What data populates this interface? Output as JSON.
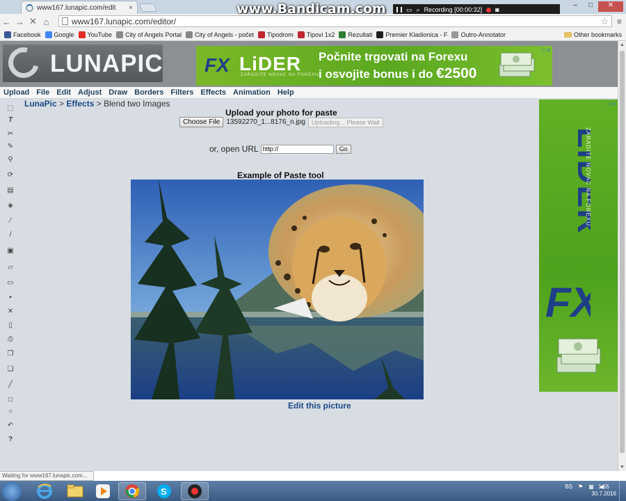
{
  "watermark": "www.Bandicam.com",
  "recorder": {
    "status": "Recording [00:00:32]"
  },
  "browser": {
    "tab_title": "www167.lunapic.com/edit",
    "tab_close": "×",
    "url": "www167.lunapic.com/editor/",
    "bookmarks": [
      {
        "label": "Facebook",
        "color": "#3b5998"
      },
      {
        "label": "Google",
        "color": "#4285f4"
      },
      {
        "label": "YouTube",
        "color": "#e52d27"
      },
      {
        "label": "City of Angels Portal",
        "color": "#888888"
      },
      {
        "label": "City of Angels - počet",
        "color": "#888888"
      },
      {
        "label": "Tipodrom",
        "color": "#c0262d"
      },
      {
        "label": "Tipovi 1x2",
        "color": "#c0262d"
      },
      {
        "label": "Rezultati",
        "color": "#2e7d32"
      },
      {
        "label": "Premier Kladionica - F",
        "color": "#1d1d1d"
      },
      {
        "label": "Outro-Annotator",
        "color": "#999999"
      }
    ],
    "other_bookmarks": "Other bookmarks"
  },
  "header": {
    "logo": "LUNAPIC",
    "ad_top": {
      "fx": "FX",
      "brand": "LiDER",
      "tagline": "ZARADITE NOVAC NA FOREXU",
      "line1": "Počnite trgovati na Forexu",
      "line2_prefix": "i osvojite bonus i do ",
      "line2_amount": "€2500"
    }
  },
  "menu": [
    "Upload",
    "File",
    "Edit",
    "Adjust",
    "Draw",
    "Borders",
    "Filters",
    "Effects",
    "Animation",
    "Help"
  ],
  "breadcrumb": {
    "root": "LunaPic",
    "section": "Effects",
    "sep": ">",
    "current": "Blend two Images"
  },
  "upload": {
    "title": "Upload your photo for paste",
    "choose_label": "Choose File",
    "filename": "13592270_1...8176_n.jpg",
    "wait_label": "Uploading... Please Wait"
  },
  "url_form": {
    "label": "or, open URL",
    "value": "http://",
    "go_label": "Go"
  },
  "example": {
    "title": "Example of Paste tool",
    "edit_link": "Edit this picture"
  },
  "status_bar": "Waiting for www167.lunapic.com...",
  "taskbar": {
    "lang": "BS",
    "time": "1:55",
    "date": "30.7.2016"
  },
  "colors": {
    "page_bg": "#d7dde3",
    "link": "#1c4a86",
    "ad_green": "#5aa820",
    "menu_text": "#22435f"
  }
}
